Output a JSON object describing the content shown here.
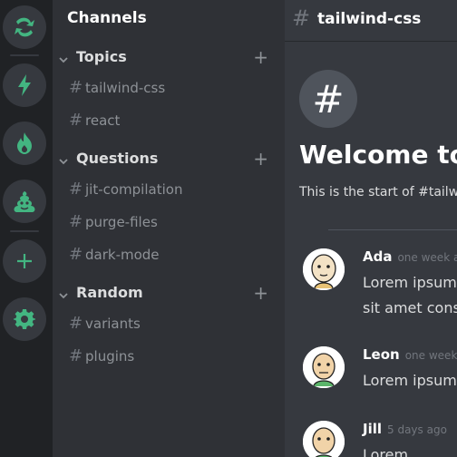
{
  "servers": [
    {
      "icon": "fish-icon"
    },
    {
      "icon": "lightning-icon"
    },
    {
      "icon": "fire-icon"
    },
    {
      "icon": "poop-icon"
    },
    {
      "icon": "plus-icon"
    },
    {
      "icon": "gear-icon"
    }
  ],
  "sidebar": {
    "header": "Channels",
    "categories": [
      {
        "label": "Topics",
        "channels": [
          "tailwind-css",
          "react"
        ]
      },
      {
        "label": "Questions",
        "channels": [
          "jit-compilation",
          "purge-files",
          "dark-mode"
        ]
      },
      {
        "label": "Random",
        "channels": [
          "variants",
          "plugins"
        ]
      }
    ]
  },
  "channel": {
    "title": "tailwind-css",
    "hash": "#"
  },
  "welcome": {
    "title": "Welcome to",
    "subtitle": "This is the start of #tailwi"
  },
  "messages": [
    {
      "name": "Ada",
      "time": "one week ag",
      "lines": [
        "Lorem ipsum",
        "sit amet cons"
      ]
    },
    {
      "name": "Leon",
      "time": "one week a",
      "lines": [
        "Lorem ipsum"
      ]
    },
    {
      "name": "Jill",
      "time": "5 days ago",
      "lines": [
        "Lorem"
      ]
    }
  ],
  "colors": {
    "accent": "#43b581",
    "rail_bg": "#202225",
    "sidebar_bg": "#2f3136",
    "main_bg": "#36393f"
  }
}
